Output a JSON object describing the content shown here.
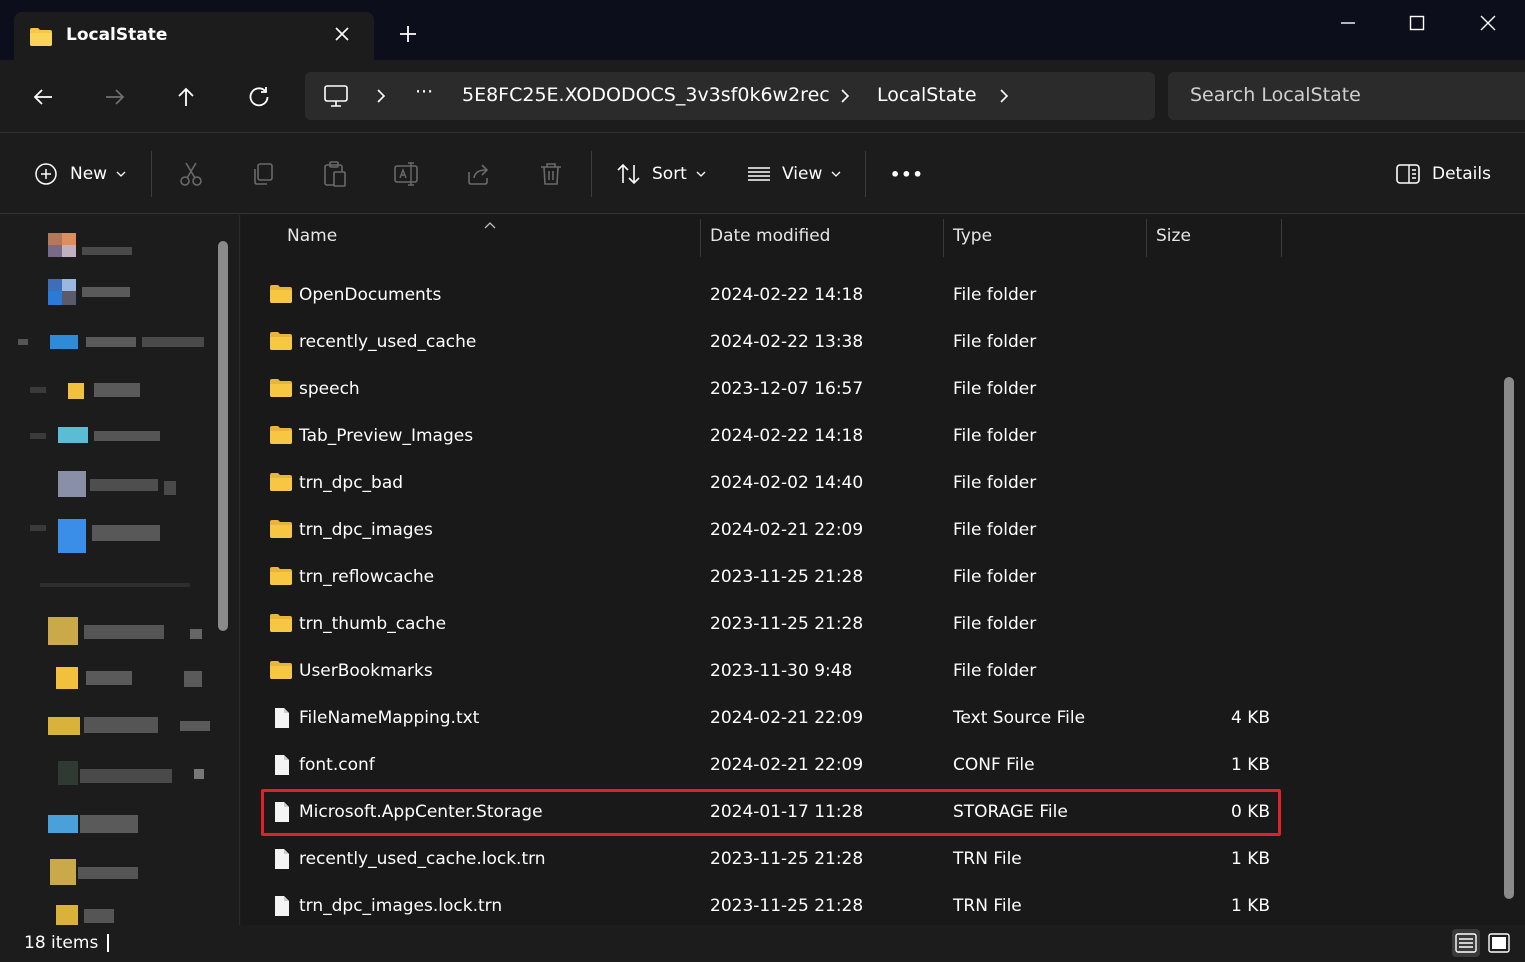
{
  "colors": {
    "titlebar_bg": "#0d0e1c",
    "window_bg": "#1c1c1c",
    "content_bg": "#191919",
    "folder_yellow": "#f7c744",
    "highlight_border": "#e0202c"
  },
  "tab": {
    "title": "LocalState",
    "icon": "folder-icon"
  },
  "address": {
    "overflow": "···",
    "segments": [
      "5E8FC25E.XODODOCS_3v3sf0k6w2rec",
      "LocalState"
    ],
    "search_placeholder": "Search LocalState"
  },
  "toolbar": {
    "new_label": "New",
    "sort_label": "Sort",
    "view_label": "View",
    "more_label": "•••",
    "details_label": "Details"
  },
  "columns": {
    "name": "Name",
    "date": "Date modified",
    "type": "Type",
    "size": "Size"
  },
  "files": [
    {
      "name": "OpenDocuments",
      "date": "2024-02-22 14:18",
      "type": "File folder",
      "size": "",
      "kind": "folder"
    },
    {
      "name": "recently_used_cache",
      "date": "2024-02-22 13:38",
      "type": "File folder",
      "size": "",
      "kind": "folder"
    },
    {
      "name": "speech",
      "date": "2023-12-07 16:57",
      "type": "File folder",
      "size": "",
      "kind": "folder"
    },
    {
      "name": "Tab_Preview_Images",
      "date": "2024-02-22 14:18",
      "type": "File folder",
      "size": "",
      "kind": "folder"
    },
    {
      "name": "trn_dpc_bad",
      "date": "2024-02-02 14:40",
      "type": "File folder",
      "size": "",
      "kind": "folder"
    },
    {
      "name": "trn_dpc_images",
      "date": "2024-02-21 22:09",
      "type": "File folder",
      "size": "",
      "kind": "folder"
    },
    {
      "name": "trn_reflowcache",
      "date": "2023-11-25 21:28",
      "type": "File folder",
      "size": "",
      "kind": "folder"
    },
    {
      "name": "trn_thumb_cache",
      "date": "2023-11-25 21:28",
      "type": "File folder",
      "size": "",
      "kind": "folder"
    },
    {
      "name": "UserBookmarks",
      "date": "2023-11-30 9:48",
      "type": "File folder",
      "size": "",
      "kind": "folder"
    },
    {
      "name": "FileNameMapping.txt",
      "date": "2024-02-21 22:09",
      "type": "Text Source File",
      "size": "4 KB",
      "kind": "file"
    },
    {
      "name": "font.conf",
      "date": "2024-02-21 22:09",
      "type": "CONF File",
      "size": "1 KB",
      "kind": "file"
    },
    {
      "name": "Microsoft.AppCenter.Storage",
      "date": "2024-01-17 11:28",
      "type": "STORAGE File",
      "size": "0 KB",
      "kind": "file",
      "highlighted": true
    },
    {
      "name": "recently_used_cache.lock.trn",
      "date": "2023-11-25 21:28",
      "type": "TRN File",
      "size": "1 KB",
      "kind": "file"
    },
    {
      "name": "trn_dpc_images.lock.trn",
      "date": "2023-11-25 21:28",
      "type": "TRN File",
      "size": "1 KB",
      "kind": "file"
    }
  ],
  "status": {
    "item_count": "18 items"
  }
}
